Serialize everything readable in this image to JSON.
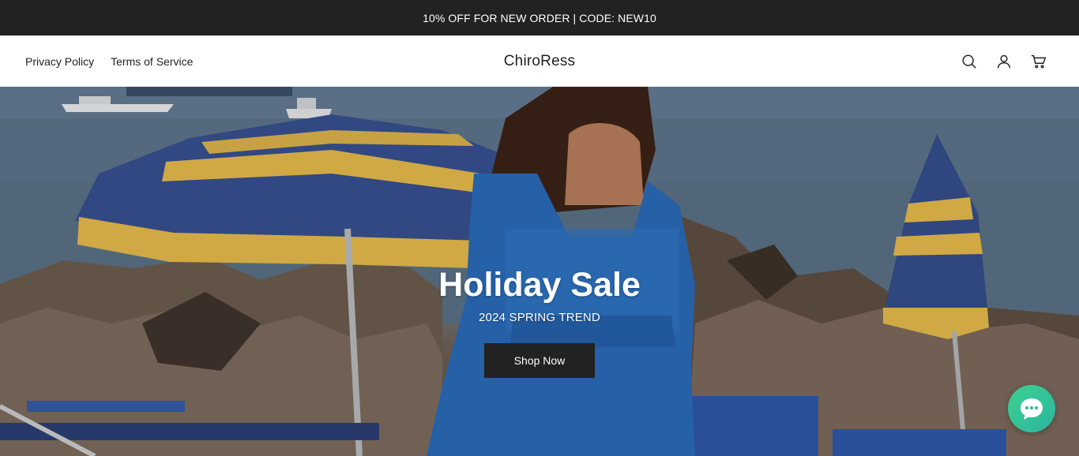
{
  "announcement": {
    "text": "10% OFF FOR NEW ORDER | CODE: NEW10"
  },
  "header": {
    "nav_links": [
      "Privacy Policy",
      "Terms of Service"
    ],
    "logo": "ChiroRess",
    "icons": [
      "search-icon",
      "account-icon",
      "cart-icon"
    ]
  },
  "hero": {
    "title": "Holiday Sale",
    "subtitle": "2024 SPRING TREND",
    "button_label": "Shop Now"
  },
  "chat": {
    "icon": "chat-bubble-icon"
  },
  "colors": {
    "announcement_bg": "#222222",
    "button_bg": "#222222",
    "chat_green": "#3cd090"
  }
}
